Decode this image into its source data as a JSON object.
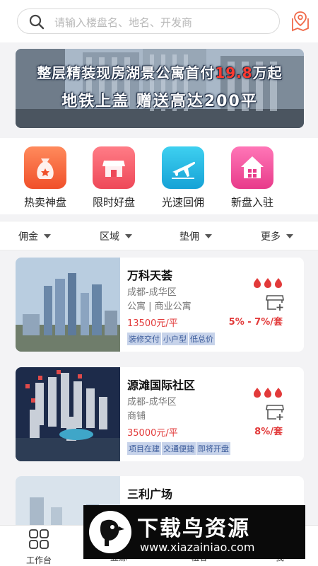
{
  "search": {
    "placeholder": "请输入楼盘名、地名、开发商"
  },
  "banner": {
    "line1_prefix": "整层精装现房湖景公寓首付",
    "line1_highlight": "19.8",
    "line1_suffix": "万起",
    "line2": "地铁上盖  赠送高达200平"
  },
  "quick_actions": [
    {
      "label": "热卖神盘",
      "icon": "money-bag-icon",
      "color": "#f4683a"
    },
    {
      "label": "限时好盘",
      "icon": "shop-icon",
      "color": "#f25c6a"
    },
    {
      "label": "光速回佣",
      "icon": "plane-icon",
      "color": "#23b6e0"
    },
    {
      "label": "新盘入驻",
      "icon": "house-icon",
      "color": "#f0529b"
    }
  ],
  "filters": [
    "佣金",
    "区域",
    "垫佣",
    "更多"
  ],
  "listings": [
    {
      "name": "万科天荟",
      "area": "成都-成华区",
      "type": "公寓 | 商业公寓",
      "price": "13500元/平",
      "tags": [
        "装修交付",
        "小户型",
        "低总价"
      ],
      "commission": "5% - 7%/套"
    },
    {
      "name": "源滩国际社区",
      "area": "成都-成华区",
      "type": "商铺",
      "price": "35000元/平",
      "tags": [
        "项目在建",
        "交通便捷",
        "即将开盘"
      ],
      "commission": "8%/套"
    },
    {
      "name": "三利广场",
      "area": "",
      "type": "",
      "price": "",
      "tags": [],
      "commission": ""
    }
  ],
  "bottom_nav": [
    {
      "label": "工作台",
      "icon": "grid-icon"
    },
    {
      "label": "盘源",
      "icon": "building-icon"
    },
    {
      "label": "租客",
      "icon": "people-icon"
    },
    {
      "label": "我",
      "icon": "user-icon"
    }
  ],
  "watermark": {
    "title": "下载鸟资源",
    "url": "www.xiazainiao.com"
  },
  "colors": {
    "accent_red": "#e23a3a",
    "tag_bg": "#c7d3ea"
  }
}
